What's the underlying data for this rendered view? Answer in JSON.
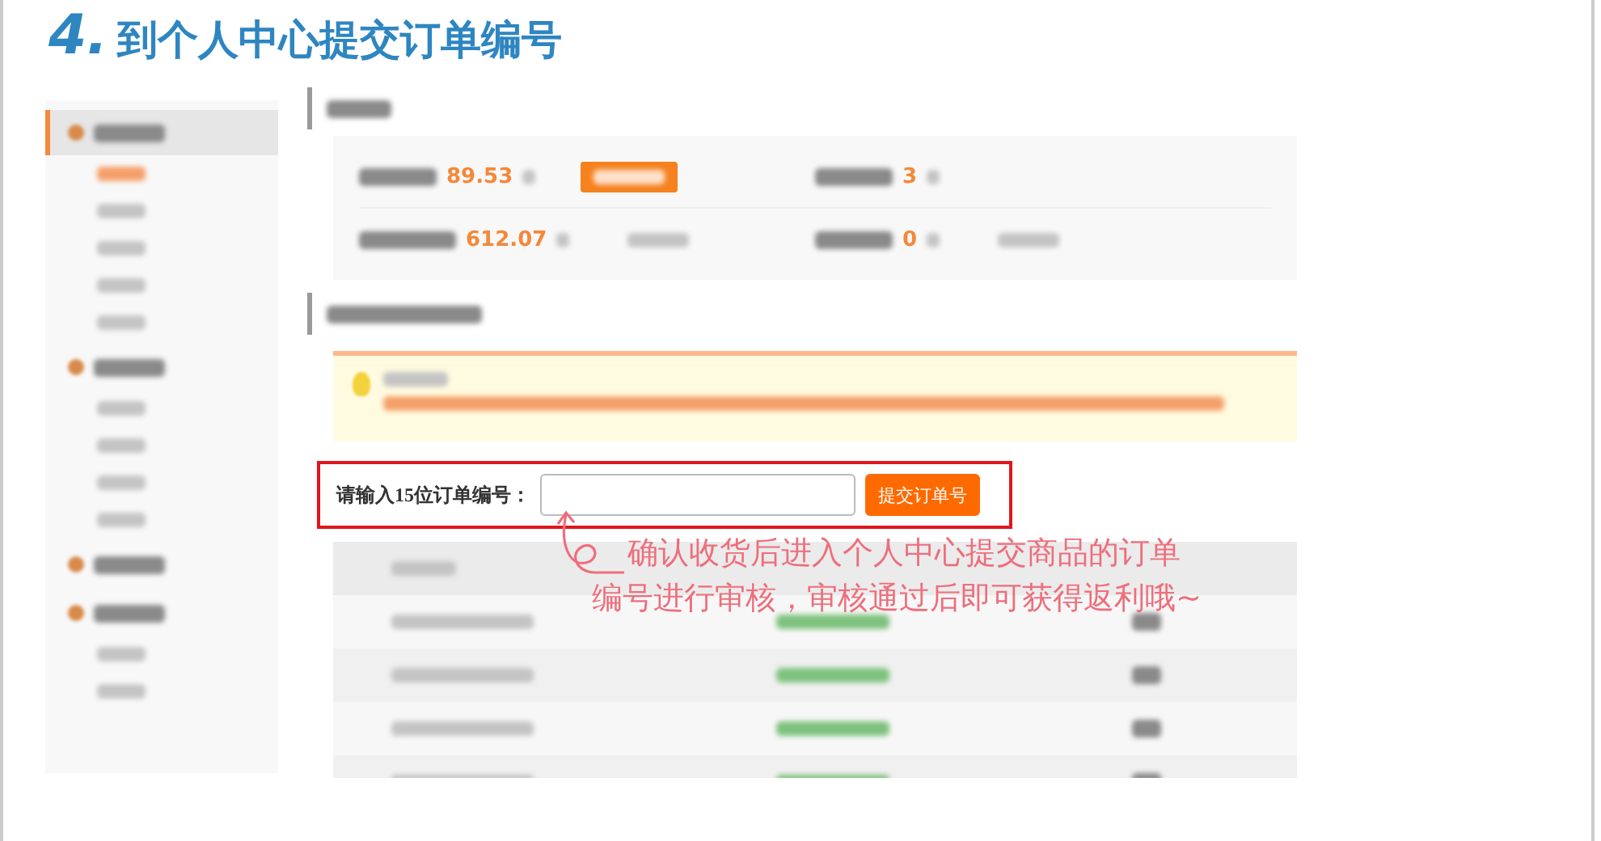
{
  "title": {
    "step": "4.",
    "text": "到个人中心提交订单编号"
  },
  "sidebar": {
    "items": [
      {
        "kind": "heading",
        "selected": true
      },
      {
        "kind": "link",
        "selected": true
      },
      {
        "kind": "link",
        "selected": false
      },
      {
        "kind": "link",
        "selected": false
      },
      {
        "kind": "link",
        "selected": false
      },
      {
        "kind": "link",
        "selected": false
      },
      {
        "kind": "heading",
        "selected": false
      },
      {
        "kind": "link",
        "selected": false
      },
      {
        "kind": "link",
        "selected": false
      },
      {
        "kind": "link",
        "selected": false
      },
      {
        "kind": "link",
        "selected": false
      },
      {
        "kind": "heading",
        "selected": false
      },
      {
        "kind": "heading",
        "selected": false
      },
      {
        "kind": "link",
        "selected": false
      },
      {
        "kind": "link",
        "selected": false
      }
    ]
  },
  "assets": {
    "stats": [
      {
        "value": "89.53",
        "kind": "button"
      },
      {
        "value": "3",
        "kind": "none"
      },
      {
        "value": "612.07",
        "kind": "link"
      },
      {
        "value": "0",
        "kind": "link"
      }
    ]
  },
  "notice": {
    "lines": [
      {
        "kind": "heading"
      },
      {
        "kind": "warning"
      }
    ]
  },
  "order_form": {
    "label": "请输入15位订单编号：",
    "button": "提交订单号"
  },
  "annotation": {
    "lines": [
      "确认收货后进入个人中心提交商品的订单",
      "编号进行审核，审核通过后即可获得返利哦~"
    ]
  },
  "table": {
    "rows": [
      {
        "kind": "header"
      },
      {
        "kind": "row"
      },
      {
        "kind": "row"
      },
      {
        "kind": "row"
      },
      {
        "kind": "row"
      }
    ]
  }
}
